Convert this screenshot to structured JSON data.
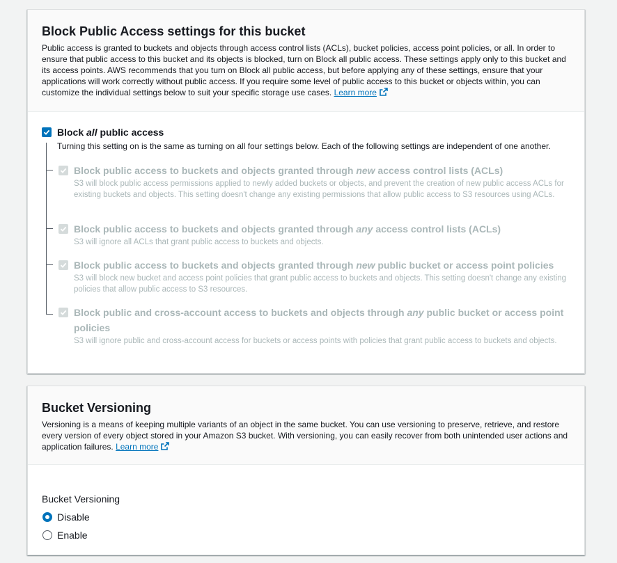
{
  "block_public_access": {
    "title": "Block Public Access settings for this bucket",
    "description": "Public access is granted to buckets and objects through access control lists (ACLs), bucket policies, access point policies, or all. In order to ensure that public access to this bucket and its objects is blocked, turn on Block all public access. These settings apply only to this bucket and its access points. AWS recommends that you turn on Block all public access, but before applying any of these settings, ensure that your applications will work correctly without public access. If you require some level of public access to this bucket or objects within, you can customize the individual settings below to suit your specific storage use cases.",
    "learn_more": "Learn more",
    "master": {
      "label_prefix": "Block ",
      "label_em": "all",
      "label_suffix": " public access",
      "checked": true,
      "description": "Turning this setting on is the same as turning on all four settings below. Each of the following settings are independent of one another."
    },
    "options": [
      {
        "label_prefix": "Block public access to buckets and objects granted through ",
        "label_em": "new",
        "label_suffix": " access control lists (ACLs)",
        "description": "S3 will block public access permissions applied to newly added buckets or objects, and prevent the creation of new public access ACLs for existing buckets and objects. This setting doesn't change any existing permissions that allow public access to S3 resources using ACLs.",
        "checked": true,
        "disabled": true
      },
      {
        "label_prefix": "Block public access to buckets and objects granted through ",
        "label_em": "any",
        "label_suffix": " access control lists (ACLs)",
        "description": "S3 will ignore all ACLs that grant public access to buckets and objects.",
        "checked": true,
        "disabled": true
      },
      {
        "label_prefix": "Block public access to buckets and objects granted through ",
        "label_em": "new",
        "label_suffix": " public bucket or access point policies",
        "description": "S3 will block new bucket and access point policies that grant public access to buckets and objects. This setting doesn't change any existing policies that allow public access to S3 resources.",
        "checked": true,
        "disabled": true
      },
      {
        "label_prefix": "Block public and cross-account access to buckets and objects through ",
        "label_em": "any",
        "label_suffix": " public bucket or access point policies",
        "description": "S3 will ignore public and cross-account access for buckets or access points with policies that grant public access to buckets and objects.",
        "checked": true,
        "disabled": true
      }
    ]
  },
  "versioning": {
    "title": "Bucket Versioning",
    "description": "Versioning is a means of keeping multiple variants of an object in the same bucket. You can use versioning to preserve, retrieve, and restore every version of every object stored in your Amazon S3 bucket. With versioning, you can easily recover from both unintended user actions and application failures.",
    "learn_more": "Learn more",
    "field_label": "Bucket Versioning",
    "options": [
      {
        "label": "Disable",
        "selected": true
      },
      {
        "label": "Enable",
        "selected": false
      }
    ]
  },
  "icons": {
    "external_link": "external-link-icon",
    "checkbox_check": "check-icon"
  },
  "colors": {
    "accent": "#0073bb",
    "disabled_text": "#aab7b8",
    "disabled_checkbox": "#d5dbdb"
  }
}
